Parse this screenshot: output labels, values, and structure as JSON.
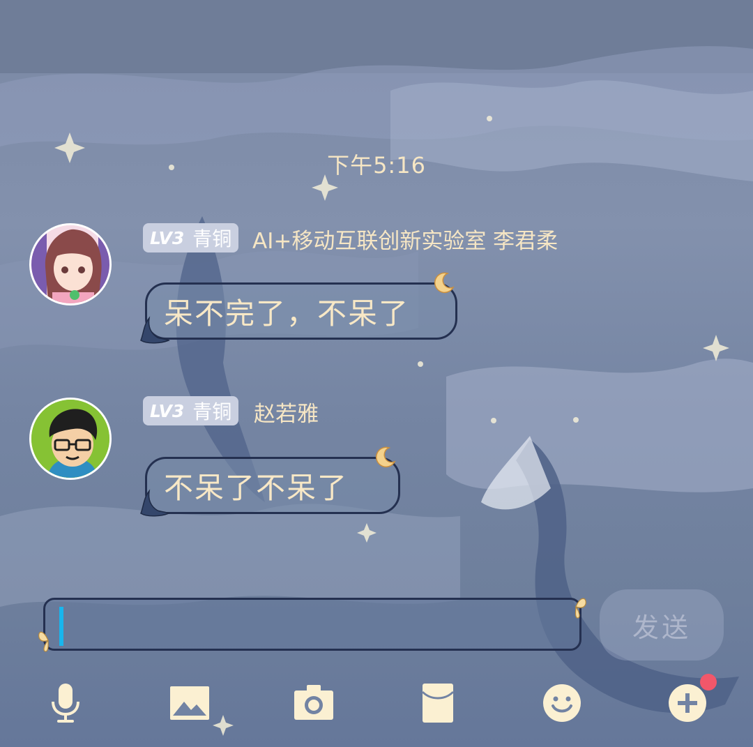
{
  "chat": {
    "timestamp": "下午5:16",
    "messages": [
      {
        "level": "LV3",
        "tier": "青铜",
        "sender": "AI+移动互联创新实验室 李君柔",
        "text": "呆不完了，不呆了"
      },
      {
        "level": "LV3",
        "tier": "青铜",
        "sender": "赵若雅",
        "text": "不呆了不呆了"
      }
    ]
  },
  "composer": {
    "input_value": "",
    "send_label": "发送"
  },
  "toolbar": {
    "icons": [
      "microphone-icon",
      "image-icon",
      "camera-icon",
      "red-packet-icon",
      "emoji-icon",
      "plus-icon"
    ],
    "has_notification_dot": true
  },
  "colors": {
    "accent_text": "#f6e6c4",
    "cursor": "#18b6ee",
    "notification_dot": "#f2576a"
  }
}
